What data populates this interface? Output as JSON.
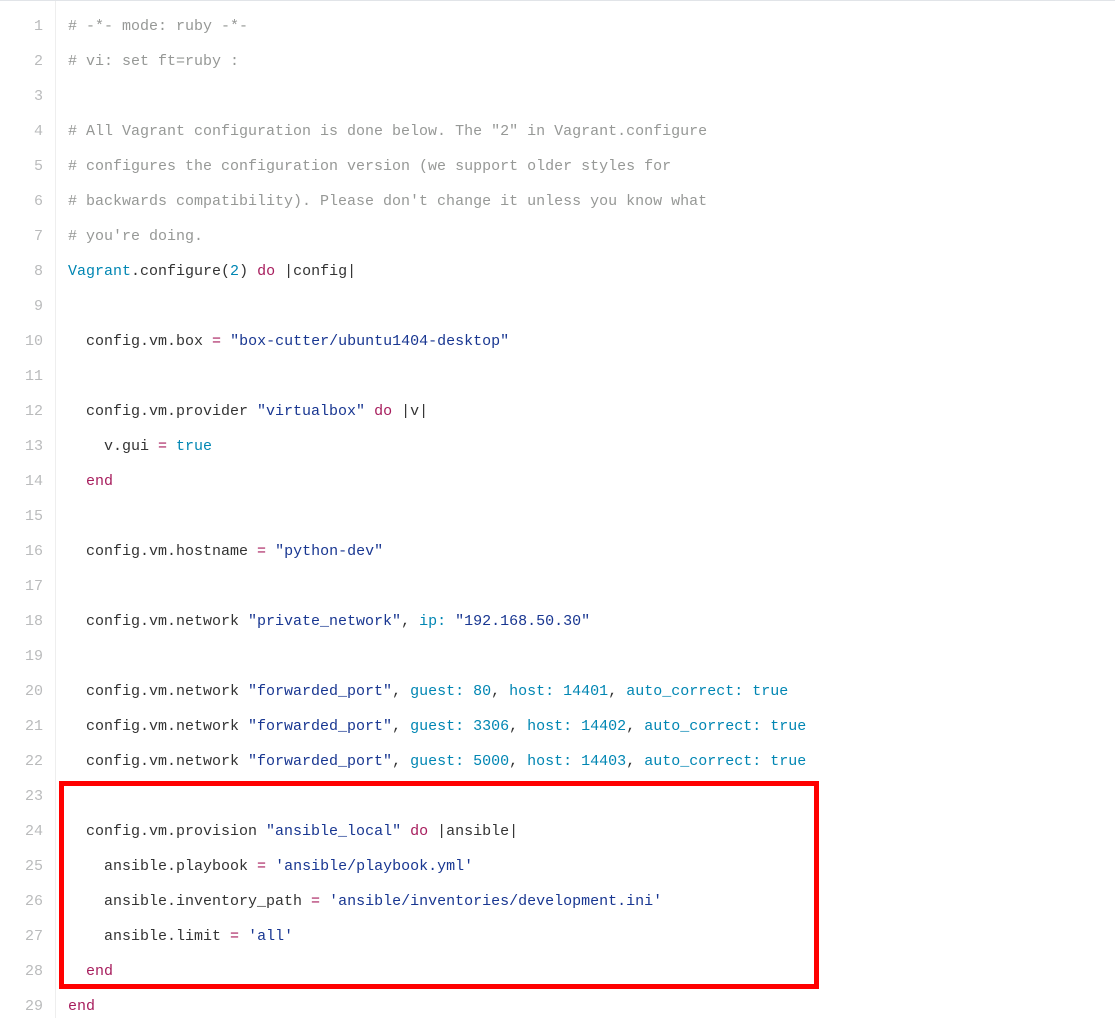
{
  "lines": [
    {
      "n": "1",
      "tokens": [
        {
          "cls": "c-comment",
          "t": "# -*- mode: ruby -*-"
        }
      ]
    },
    {
      "n": "2",
      "tokens": [
        {
          "cls": "c-comment",
          "t": "# vi: set ft=ruby :"
        }
      ]
    },
    {
      "n": "3",
      "tokens": []
    },
    {
      "n": "4",
      "tokens": [
        {
          "cls": "c-comment",
          "t": "# All Vagrant configuration is done below. The \"2\" in Vagrant.configure"
        }
      ]
    },
    {
      "n": "5",
      "tokens": [
        {
          "cls": "c-comment",
          "t": "# configures the configuration version (we support older styles for"
        }
      ]
    },
    {
      "n": "6",
      "tokens": [
        {
          "cls": "c-comment",
          "t": "# backwards compatibility). Please don't change it unless you know what"
        }
      ]
    },
    {
      "n": "7",
      "tokens": [
        {
          "cls": "c-comment",
          "t": "# you're doing."
        }
      ]
    },
    {
      "n": "8",
      "tokens": [
        {
          "cls": "c-const",
          "t": "Vagrant"
        },
        {
          "cls": "c-plain",
          "t": ".configure("
        },
        {
          "cls": "c-num",
          "t": "2"
        },
        {
          "cls": "c-plain",
          "t": ") "
        },
        {
          "cls": "c-kw",
          "t": "do"
        },
        {
          "cls": "c-plain",
          "t": " |"
        },
        {
          "cls": "c-plain",
          "t": "config"
        },
        {
          "cls": "c-plain",
          "t": "|"
        }
      ]
    },
    {
      "n": "9",
      "tokens": []
    },
    {
      "n": "10",
      "tokens": [
        {
          "cls": "c-plain",
          "t": "  config.vm.box "
        },
        {
          "cls": "c-kw",
          "t": "="
        },
        {
          "cls": "c-plain",
          "t": " "
        },
        {
          "cls": "c-str",
          "t": "\"box-cutter/ubuntu1404-desktop\""
        }
      ]
    },
    {
      "n": "11",
      "tokens": []
    },
    {
      "n": "12",
      "tokens": [
        {
          "cls": "c-plain",
          "t": "  config.vm.provider "
        },
        {
          "cls": "c-str",
          "t": "\"virtualbox\""
        },
        {
          "cls": "c-plain",
          "t": " "
        },
        {
          "cls": "c-kw",
          "t": "do"
        },
        {
          "cls": "c-plain",
          "t": " |"
        },
        {
          "cls": "c-plain",
          "t": "v"
        },
        {
          "cls": "c-plain",
          "t": "|"
        }
      ]
    },
    {
      "n": "13",
      "tokens": [
        {
          "cls": "c-plain",
          "t": "    v.gui "
        },
        {
          "cls": "c-kw",
          "t": "="
        },
        {
          "cls": "c-plain",
          "t": " "
        },
        {
          "cls": "c-bool",
          "t": "true"
        }
      ]
    },
    {
      "n": "14",
      "tokens": [
        {
          "cls": "c-plain",
          "t": "  "
        },
        {
          "cls": "c-kw",
          "t": "end"
        }
      ]
    },
    {
      "n": "15",
      "tokens": []
    },
    {
      "n": "16",
      "tokens": [
        {
          "cls": "c-plain",
          "t": "  config.vm.hostname "
        },
        {
          "cls": "c-kw",
          "t": "="
        },
        {
          "cls": "c-plain",
          "t": " "
        },
        {
          "cls": "c-str",
          "t": "\"python-dev\""
        }
      ]
    },
    {
      "n": "17",
      "tokens": []
    },
    {
      "n": "18",
      "tokens": [
        {
          "cls": "c-plain",
          "t": "  config.vm.network "
        },
        {
          "cls": "c-str",
          "t": "\"private_network\""
        },
        {
          "cls": "c-plain",
          "t": ", "
        },
        {
          "cls": "c-sym",
          "t": "ip:"
        },
        {
          "cls": "c-plain",
          "t": " "
        },
        {
          "cls": "c-str",
          "t": "\"192.168.50.30\""
        }
      ]
    },
    {
      "n": "19",
      "tokens": []
    },
    {
      "n": "20",
      "tokens": [
        {
          "cls": "c-plain",
          "t": "  config.vm.network "
        },
        {
          "cls": "c-str",
          "t": "\"forwarded_port\""
        },
        {
          "cls": "c-plain",
          "t": ", "
        },
        {
          "cls": "c-sym",
          "t": "guest:"
        },
        {
          "cls": "c-plain",
          "t": " "
        },
        {
          "cls": "c-num",
          "t": "80"
        },
        {
          "cls": "c-plain",
          "t": ", "
        },
        {
          "cls": "c-sym",
          "t": "host:"
        },
        {
          "cls": "c-plain",
          "t": " "
        },
        {
          "cls": "c-num",
          "t": "14401"
        },
        {
          "cls": "c-plain",
          "t": ", "
        },
        {
          "cls": "c-sym",
          "t": "auto_correct:"
        },
        {
          "cls": "c-plain",
          "t": " "
        },
        {
          "cls": "c-bool",
          "t": "true"
        }
      ]
    },
    {
      "n": "21",
      "tokens": [
        {
          "cls": "c-plain",
          "t": "  config.vm.network "
        },
        {
          "cls": "c-str",
          "t": "\"forwarded_port\""
        },
        {
          "cls": "c-plain",
          "t": ", "
        },
        {
          "cls": "c-sym",
          "t": "guest:"
        },
        {
          "cls": "c-plain",
          "t": " "
        },
        {
          "cls": "c-num",
          "t": "3306"
        },
        {
          "cls": "c-plain",
          "t": ", "
        },
        {
          "cls": "c-sym",
          "t": "host:"
        },
        {
          "cls": "c-plain",
          "t": " "
        },
        {
          "cls": "c-num",
          "t": "14402"
        },
        {
          "cls": "c-plain",
          "t": ", "
        },
        {
          "cls": "c-sym",
          "t": "auto_correct:"
        },
        {
          "cls": "c-plain",
          "t": " "
        },
        {
          "cls": "c-bool",
          "t": "true"
        }
      ]
    },
    {
      "n": "22",
      "tokens": [
        {
          "cls": "c-plain",
          "t": "  config.vm.network "
        },
        {
          "cls": "c-str",
          "t": "\"forwarded_port\""
        },
        {
          "cls": "c-plain",
          "t": ", "
        },
        {
          "cls": "c-sym",
          "t": "guest:"
        },
        {
          "cls": "c-plain",
          "t": " "
        },
        {
          "cls": "c-num",
          "t": "5000"
        },
        {
          "cls": "c-plain",
          "t": ", "
        },
        {
          "cls": "c-sym",
          "t": "host:"
        },
        {
          "cls": "c-plain",
          "t": " "
        },
        {
          "cls": "c-num",
          "t": "14403"
        },
        {
          "cls": "c-plain",
          "t": ", "
        },
        {
          "cls": "c-sym",
          "t": "auto_correct:"
        },
        {
          "cls": "c-plain",
          "t": " "
        },
        {
          "cls": "c-bool",
          "t": "true"
        }
      ]
    },
    {
      "n": "23",
      "tokens": []
    },
    {
      "n": "24",
      "tokens": [
        {
          "cls": "c-plain",
          "t": "  config.vm.provision "
        },
        {
          "cls": "c-str",
          "t": "\"ansible_local\""
        },
        {
          "cls": "c-plain",
          "t": " "
        },
        {
          "cls": "c-kw",
          "t": "do"
        },
        {
          "cls": "c-plain",
          "t": " |"
        },
        {
          "cls": "c-plain",
          "t": "ansible"
        },
        {
          "cls": "c-plain",
          "t": "|"
        }
      ]
    },
    {
      "n": "25",
      "tokens": [
        {
          "cls": "c-plain",
          "t": "    ansible.playbook "
        },
        {
          "cls": "c-kw",
          "t": "="
        },
        {
          "cls": "c-plain",
          "t": " "
        },
        {
          "cls": "c-str",
          "t": "'ansible/playbook.yml'"
        }
      ]
    },
    {
      "n": "26",
      "tokens": [
        {
          "cls": "c-plain",
          "t": "    ansible.inventory_path "
        },
        {
          "cls": "c-kw",
          "t": "="
        },
        {
          "cls": "c-plain",
          "t": " "
        },
        {
          "cls": "c-str",
          "t": "'ansible/inventories/development.ini'"
        }
      ]
    },
    {
      "n": "27",
      "tokens": [
        {
          "cls": "c-plain",
          "t": "    ansible.limit "
        },
        {
          "cls": "c-kw",
          "t": "="
        },
        {
          "cls": "c-plain",
          "t": " "
        },
        {
          "cls": "c-str",
          "t": "'all'"
        }
      ]
    },
    {
      "n": "28",
      "tokens": [
        {
          "cls": "c-plain",
          "t": "  "
        },
        {
          "cls": "c-kw",
          "t": "end"
        }
      ]
    },
    {
      "n": "29",
      "tokens": [
        {
          "cls": "c-kw",
          "t": "end"
        }
      ]
    }
  ],
  "highlight": {
    "startLine": 23,
    "endLine": 28
  }
}
